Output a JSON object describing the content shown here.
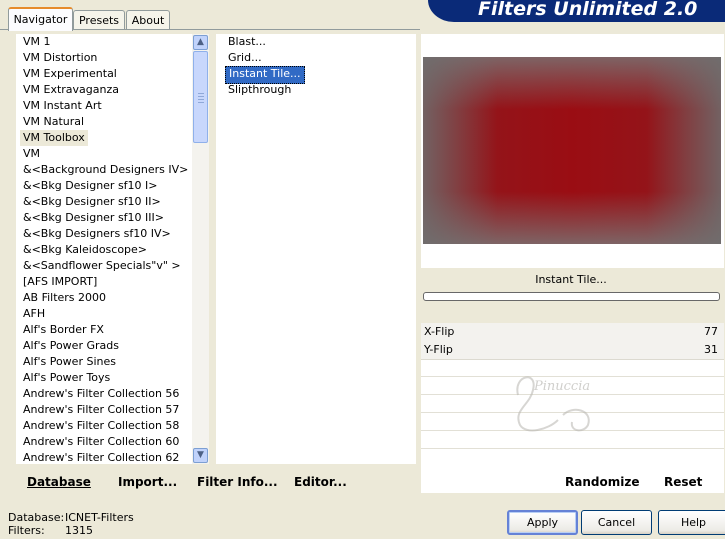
{
  "app_title": "Filters Unlimited 2.0",
  "tabs": [
    {
      "label": "Navigator",
      "active": true
    },
    {
      "label": "Presets",
      "active": false
    },
    {
      "label": "About",
      "active": false
    }
  ],
  "categories": [
    "VM 1",
    "VM Distortion",
    "VM Experimental",
    "VM Extravaganza",
    "VM Instant Art",
    "VM Natural",
    "VM Toolbox",
    "VM",
    "&<Background Designers IV>",
    "&<Bkg Designer sf10 I>",
    "&<Bkg Designer sf10 II>",
    "&<Bkg Designer sf10 III>",
    "&<Bkg Designers sf10 IV>",
    "&<Bkg Kaleidoscope>",
    "&<Sandflower Specials\"v\" >",
    "[AFS IMPORT]",
    "AB Filters 2000",
    "AFH",
    "Alf's Border FX",
    "Alf's Power Grads",
    "Alf's Power Sines",
    "Alf's Power Toys",
    "Andrew's Filter Collection 56",
    "Andrew's Filter Collection 57",
    "Andrew's Filter Collection 58",
    "Andrew's Filter Collection 60",
    "Andrew's Filter Collection 62"
  ],
  "selected_category": "VM Toolbox",
  "filters": [
    "Blast...",
    "Grid...",
    "Instant Tile...",
    "Slipthrough"
  ],
  "selected_filter": "Instant Tile...",
  "left_toolbar": {
    "database": "Database",
    "import": "Import...",
    "filter_info": "Filter Info...",
    "editor": "Editor..."
  },
  "current_filter_title": "Instant Tile...",
  "progress": 0,
  "params": [
    {
      "label": "X-Flip",
      "value": "77"
    },
    {
      "label": "Y-Flip",
      "value": "31"
    }
  ],
  "right_toolbar": {
    "randomize": "Randomize",
    "reset": "Reset"
  },
  "status": {
    "database_label": "Database:",
    "database_value": "ICNET-Filters",
    "filters_label": "Filters:",
    "filters_value": "1315"
  },
  "dialog_buttons": {
    "apply": "Apply",
    "cancel": "Cancel",
    "help": "Help"
  },
  "watermark_text": "Pinuccia",
  "colors": {
    "banner": "#0a2a78",
    "selection": "#316ac5",
    "preview_red": "#9a0d13",
    "panel_bg": "#ece9d8"
  }
}
